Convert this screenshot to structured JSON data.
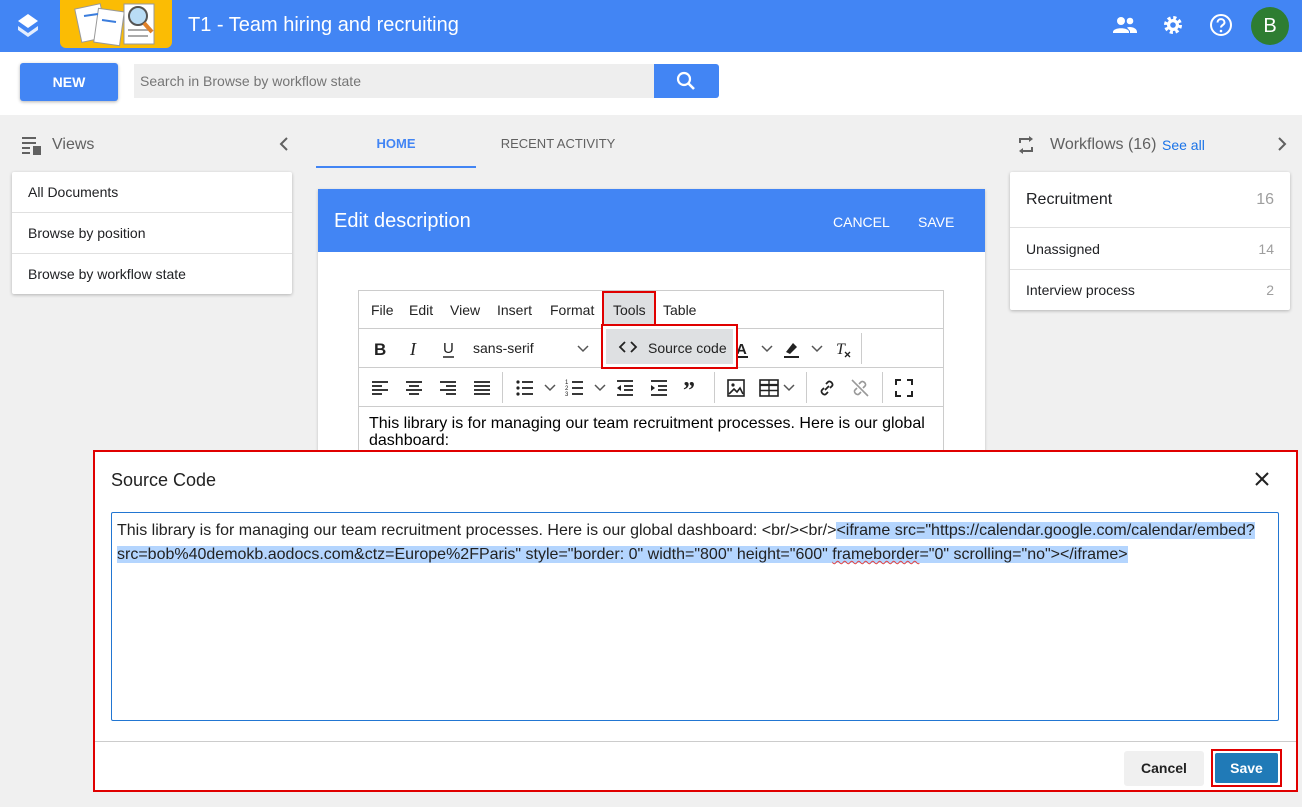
{
  "header": {
    "title": "T1 - Team hiring and recruiting",
    "avatar_letter": "B",
    "brand_color": "#4285f4"
  },
  "toolbar": {
    "new_label": "NEW",
    "search_placeholder": "Search in Browse by workflow state"
  },
  "views": {
    "title": "Views",
    "items": [
      {
        "label": "All Documents"
      },
      {
        "label": "Browse by position"
      },
      {
        "label": "Browse by workflow state"
      }
    ]
  },
  "tabs": [
    {
      "label": "HOME",
      "active": true
    },
    {
      "label": "RECENT ACTIVITY",
      "active": false
    }
  ],
  "editor": {
    "title": "Edit description",
    "cancel_label": "CANCEL",
    "save_label": "SAVE",
    "menus": [
      "File",
      "Edit",
      "View",
      "Insert",
      "Format",
      "Tools",
      "Table"
    ],
    "font": "sans-serif",
    "content": "This library is for managing our team recruitment processes. Here is our global dashboard:",
    "tools_menu_item": "Source code"
  },
  "workflows": {
    "title": "Workflows (16)",
    "see_all": "See all",
    "main": {
      "name": "Recruitment",
      "count": "16"
    },
    "rows": [
      {
        "name": "Unassigned",
        "count": "14"
      },
      {
        "name": "Interview process",
        "count": "2"
      }
    ]
  },
  "dialog": {
    "title": "Source Code",
    "text_plain": "This library is for managing our team recruitment processes. Here is our global dashboard: <br/><br/>",
    "text_selected_1": "<iframe src=\"https://calendar.google.com/calendar/embed?src=bob%40demokb.aodocs.com&ctz=Europe%2FParis\" style=\"border: 0\" width=\"800\" height=\"600\" ",
    "text_selected_squig": "frameborder",
    "text_selected_2": "=\"0\" scrolling=\"no\"></iframe>",
    "cancel_label": "Cancel",
    "save_label": "Save"
  }
}
